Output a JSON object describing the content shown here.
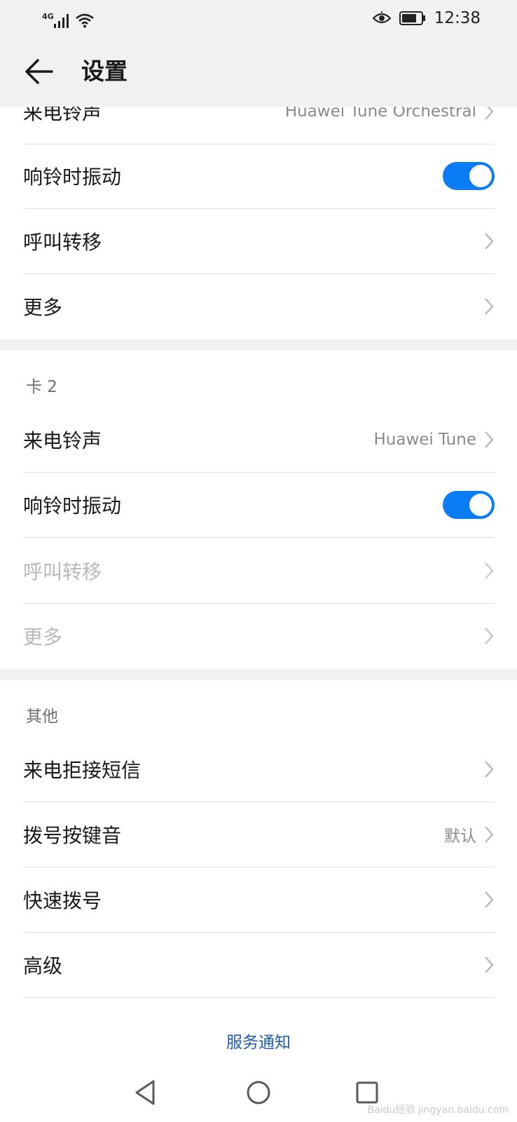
{
  "status_bar": {
    "network": "4G",
    "time": "12:38",
    "icons": [
      "signal-icon",
      "wifi-icon",
      "eye-comfort-icon",
      "battery-icon"
    ]
  },
  "app_bar": {
    "title": "设置",
    "back_icon": "arrow-left-icon"
  },
  "card1": {
    "items": [
      {
        "label": "来电铃声",
        "value": "Huawei Tune Orchestral"
      },
      {
        "label": "响铃时振动",
        "toggle": true
      },
      {
        "label": "呼叫转移"
      },
      {
        "label": "更多"
      }
    ]
  },
  "card2": {
    "header": "卡 2",
    "items": [
      {
        "label": "来电铃声",
        "value": "Huawei Tune"
      },
      {
        "label": "响铃时振动",
        "toggle": true
      },
      {
        "label": "呼叫转移",
        "disabled": true
      },
      {
        "label": "更多",
        "disabled": true
      }
    ]
  },
  "other": {
    "header": "其他",
    "items": [
      {
        "label": "来电拒接短信"
      },
      {
        "label": "拨号按键音",
        "value": "默认"
      },
      {
        "label": "快速拨号"
      },
      {
        "label": "高级"
      }
    ]
  },
  "footer_link": "服务通知",
  "nav_bar": {
    "icons": [
      "back-triangle-icon",
      "home-circle-icon",
      "recents-square-icon"
    ]
  },
  "watermark": "Baidu经验 jingyan.baidu.com",
  "colors": {
    "accent": "#0a7cf6",
    "link": "#1c5da8",
    "background_bar": "#f1f1f1"
  }
}
